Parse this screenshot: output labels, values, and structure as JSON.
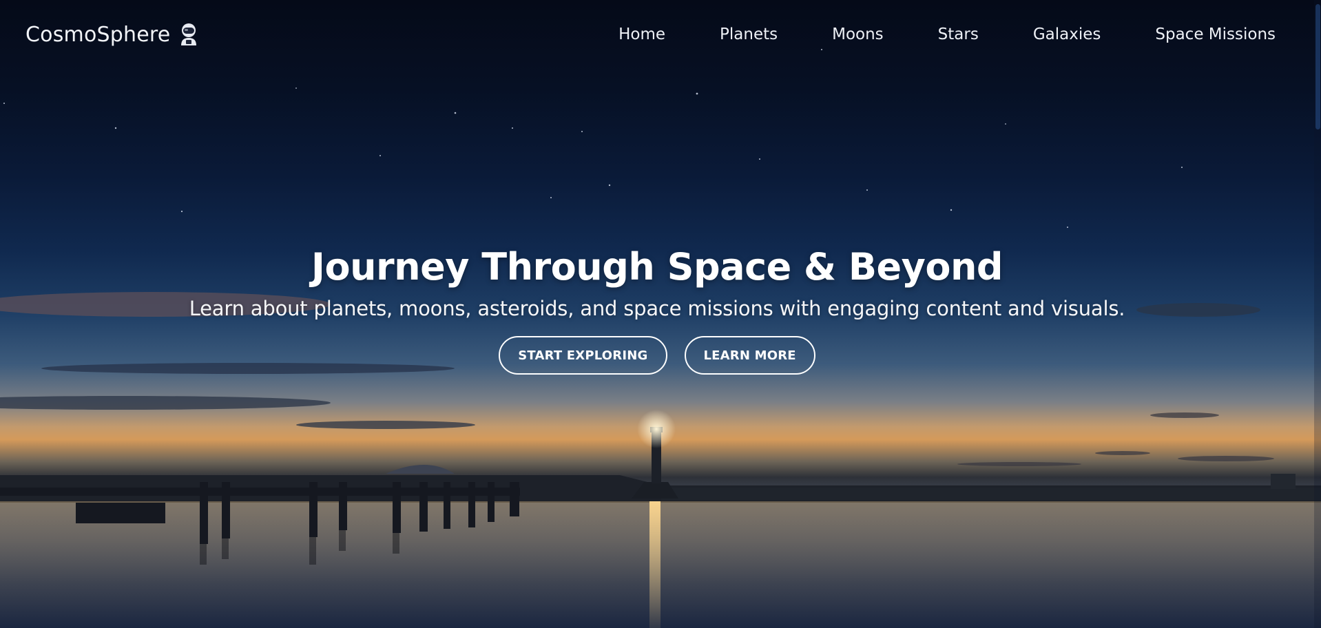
{
  "brand": {
    "name": "CosmoSphere",
    "icon": "astronaut-icon"
  },
  "nav": {
    "items": [
      {
        "label": "Home"
      },
      {
        "label": "Planets"
      },
      {
        "label": "Moons"
      },
      {
        "label": "Stars"
      },
      {
        "label": "Galaxies"
      },
      {
        "label": "Space Missions"
      }
    ]
  },
  "hero": {
    "title": "Journey Through Space & Beyond",
    "subtitle": "Learn about planets, moons, asteroids, and space missions with engaging content and visuals.",
    "buttons": [
      {
        "label": "START EXPLORING"
      },
      {
        "label": "LEARN MORE"
      }
    ]
  },
  "colors": {
    "night_sky": "#050a18",
    "horizon_glow": "#d59a5a",
    "text": "#ffffff",
    "button_border": "#ffffff"
  }
}
